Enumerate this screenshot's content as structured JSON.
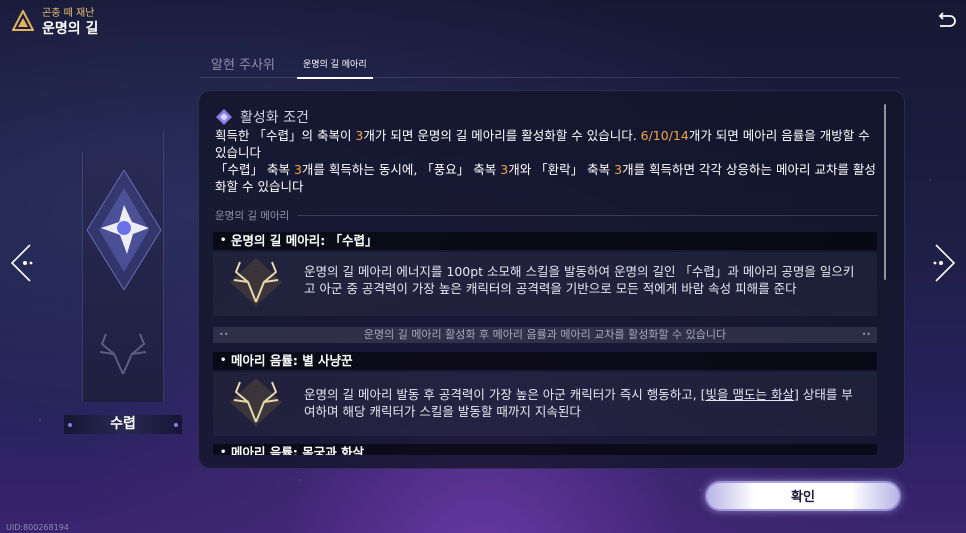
{
  "header": {
    "subtitle": "곤충 떼 재난",
    "title": "운명의 길",
    "logo_icon": "triangle-emblem-icon",
    "back_icon": "back-arrow-icon"
  },
  "tabs": [
    {
      "label": "알현 주사위",
      "active": false
    },
    {
      "label": "운명의 길 메아리",
      "active": true
    }
  ],
  "card": {
    "name": "수렵",
    "gem_icon": "star-crystal-icon",
    "emblem_icon": "stag-emblem-icon"
  },
  "condition": {
    "title": "활성화 조건",
    "line1_a": "획득한 「수렵」의 축복이 ",
    "line1_b": "3",
    "line1_c": "개가 되면 운명의 길 메아리를 활성화할 수 있습니다. ",
    "line1_d": "6/10/14",
    "line1_e": "개가 되면 메아리 음률을 개방할 수 있습니다",
    "line2_a": "「수렵」 축복 ",
    "line2_b": "3",
    "line2_c": "개를 획득하는 동시에, 「풍요」 축복 ",
    "line2_d": "3",
    "line2_e": "개와 「환락」 축복 ",
    "line2_f": "3",
    "line2_g": "개를 획득하면 각각 상응하는 메아리 교차를 활성화할 수 있습니다"
  },
  "section": {
    "label": "운명의 길 메아리"
  },
  "items": [
    {
      "title": "운명의 길 메아리: 「수렵」",
      "desc": "운명의 길 메아리 에너지를 100pt 소모해 스킬을 발동하여 운명의 길인 「수렵」과 메아리 공명을 일으키고 아군 중 공격력이 가장 높은 캐릭터의 공격력을 기반으로 모든 적에게 바람 속성 피해를 준다"
    },
    {
      "title": "메아리 음률: 별 사냥꾼",
      "desc_a": "운명의 길 메아리 발동 후 공격력이 가장 높은 아군 캐릭터가 즉시 행동하고, ",
      "desc_link": "[빛을 맴도는 화살]",
      "desc_b": " 상태를 부여하며 해당 캐릭터가 스킬을 발동할 때까지 지속된다"
    },
    {
      "title": "메아리 음률: 목궁과 화살"
    }
  ],
  "notice": "운명의 길 메아리 활성화 후 메아리 음률과 메아리 교차를 활성화할 수 있습니다",
  "confirm_label": "확인",
  "uid": "UID:800268194",
  "nav": {
    "left_icon": "left-arrow-icon",
    "right_icon": "right-arrow-icon"
  },
  "colors": {
    "highlight": "#f2a24a",
    "accent": "#8a7be0"
  }
}
